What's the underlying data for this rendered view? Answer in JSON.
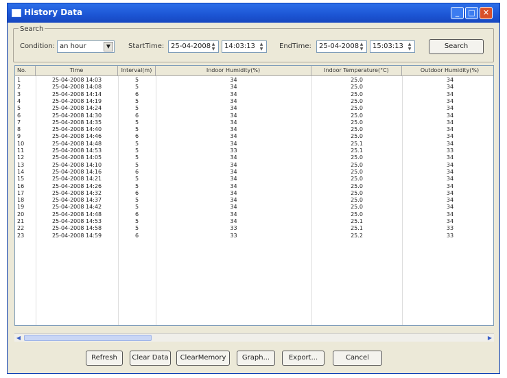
{
  "window": {
    "title": "History Data"
  },
  "search": {
    "group_label": "Search",
    "condition_label": "Condition:",
    "condition_value": "an hour",
    "start_label": "StartTime:",
    "start_date": "25-04-2008",
    "start_time": "14:03:13",
    "end_label": "EndTime:",
    "end_date": "25-04-2008",
    "end_time": "15:03:13",
    "search_button": "Search"
  },
  "table": {
    "columns": [
      "No.",
      "Time",
      "Interval(m)",
      "Indoor Humidity(%)",
      "Indoor Temperature(°C)",
      "Outdoor Humidity(%)"
    ],
    "rows": [
      [
        "1",
        "25-04-2008 14:03",
        "5",
        "34",
        "25.0",
        "34"
      ],
      [
        "2",
        "25-04-2008 14:08",
        "5",
        "34",
        "25.0",
        "34"
      ],
      [
        "3",
        "25-04-2008 14:14",
        "6",
        "34",
        "25.0",
        "34"
      ],
      [
        "4",
        "25-04-2008 14:19",
        "5",
        "34",
        "25.0",
        "34"
      ],
      [
        "5",
        "25-04-2008 14:24",
        "5",
        "34",
        "25.0",
        "34"
      ],
      [
        "6",
        "25-04-2008 14:30",
        "6",
        "34",
        "25.0",
        "34"
      ],
      [
        "7",
        "25-04-2008 14:35",
        "5",
        "34",
        "25.0",
        "34"
      ],
      [
        "8",
        "25-04-2008 14:40",
        "5",
        "34",
        "25.0",
        "34"
      ],
      [
        "9",
        "25-04-2008 14:46",
        "6",
        "34",
        "25.0",
        "34"
      ],
      [
        "10",
        "25-04-2008 14:48",
        "5",
        "34",
        "25.1",
        "34"
      ],
      [
        "11",
        "25-04-2008 14:53",
        "5",
        "33",
        "25.1",
        "33"
      ],
      [
        "12",
        "25-04-2008 14:05",
        "5",
        "34",
        "25.0",
        "34"
      ],
      [
        "13",
        "25-04-2008 14:10",
        "5",
        "34",
        "25.0",
        "34"
      ],
      [
        "14",
        "25-04-2008 14:16",
        "6",
        "34",
        "25.0",
        "34"
      ],
      [
        "15",
        "25-04-2008 14:21",
        "5",
        "34",
        "25.0",
        "34"
      ],
      [
        "16",
        "25-04-2008 14:26",
        "5",
        "34",
        "25.0",
        "34"
      ],
      [
        "17",
        "25-04-2008 14:32",
        "6",
        "34",
        "25.0",
        "34"
      ],
      [
        "18",
        "25-04-2008 14:37",
        "5",
        "34",
        "25.0",
        "34"
      ],
      [
        "19",
        "25-04-2008 14:42",
        "5",
        "34",
        "25.0",
        "34"
      ],
      [
        "20",
        "25-04-2008 14:48",
        "6",
        "34",
        "25.0",
        "34"
      ],
      [
        "21",
        "25-04-2008 14:53",
        "5",
        "34",
        "25.1",
        "34"
      ],
      [
        "22",
        "25-04-2008 14:58",
        "5",
        "33",
        "25.1",
        "33"
      ],
      [
        "23",
        "25-04-2008 14:59",
        "6",
        "33",
        "25.2",
        "33"
      ]
    ]
  },
  "buttons": {
    "refresh": "Refresh",
    "clear_data": "Clear Data",
    "clear_memory": "ClearMemory",
    "graph": "Graph...",
    "export": "Export...",
    "cancel": "Cancel"
  },
  "icons": {
    "title_icon": "window-icon",
    "minimize": "minimize-icon",
    "maximize": "maximize-icon",
    "close": "close-icon",
    "dropdown": "chevron-down-icon",
    "scroll_left": "arrow-left-icon",
    "scroll_right": "arrow-right-icon"
  },
  "colors": {
    "titlebar": "#2d6fe9",
    "window_bg": "#ece9d8",
    "close_button": "#d8502a"
  }
}
